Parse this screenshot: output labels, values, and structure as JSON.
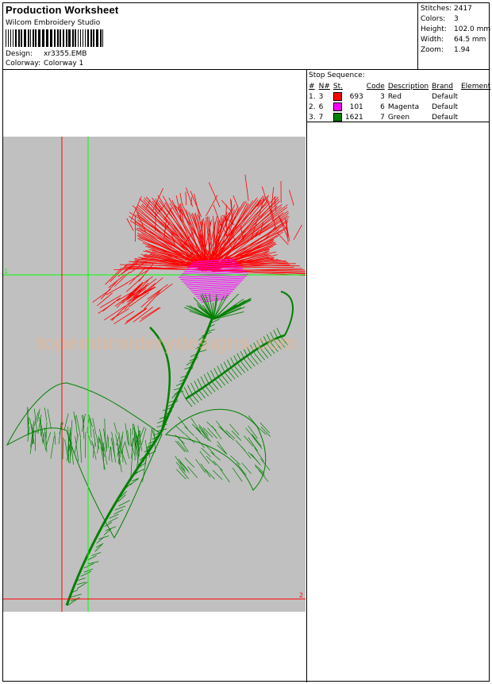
{
  "header": {
    "title": "Production Worksheet",
    "software": "Wilcom Embroidery Studio",
    "design_label": "Design:",
    "design_value": "xr3355.EMB",
    "colorway_label": "Colorway:",
    "colorway_value": "Colorway 1"
  },
  "stats": [
    {
      "label": "Stitches:",
      "value": "2417"
    },
    {
      "label": "Colors:",
      "value": "3"
    },
    {
      "label": "Height:",
      "value": "102.0 mm"
    },
    {
      "label": "Width:",
      "value": "64.5 mm"
    },
    {
      "label": "Zoom:",
      "value": "1.94"
    }
  ],
  "stop_sequence": {
    "title": "Stop Sequence:",
    "columns": [
      "#",
      "N#",
      "St.",
      "Code",
      "Description",
      "Brand",
      "Element"
    ],
    "rows": [
      {
        "num": "1.",
        "n": "3",
        "color": "#ff0000",
        "st": "693",
        "code": "3",
        "description": "Red",
        "brand": "Default",
        "element": ""
      },
      {
        "num": "2.",
        "n": "6",
        "color": "#ff00ff",
        "st": "101",
        "code": "6",
        "description": "Magenta",
        "brand": "Default",
        "element": ""
      },
      {
        "num": "3.",
        "n": "7",
        "color": "#008000",
        "st": "1621",
        "code": "7",
        "description": "Green",
        "brand": "Default",
        "element": ""
      }
    ]
  },
  "canvas": {
    "marker_1": "1",
    "marker_2": "2",
    "watermark": "topembroiderydesigns.com"
  },
  "colors": {
    "red": "#ff0000",
    "magenta": "#ff00ff",
    "green": "#008000",
    "guide_red": "#ff0000",
    "guide_green": "#00ff00",
    "canvas_bg": "#c0c0c0"
  }
}
